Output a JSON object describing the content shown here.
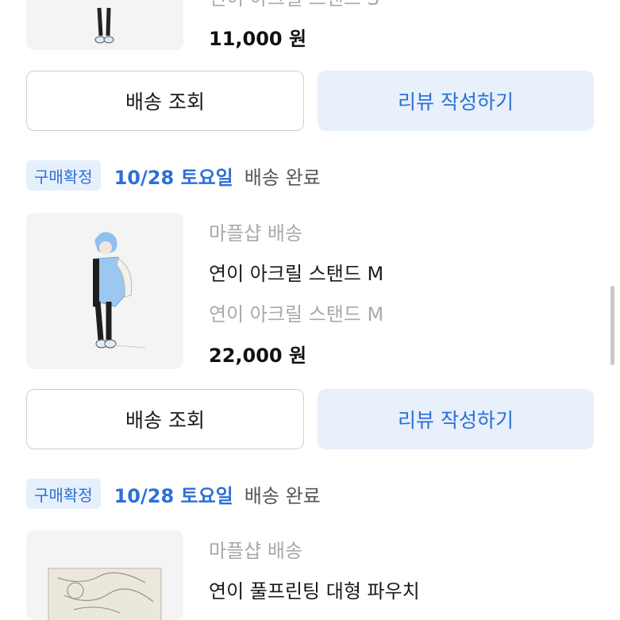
{
  "orders": [
    {
      "product": {
        "price": "11,000 원",
        "partial_option": "연이 아크릴 스탠드 S"
      },
      "buttons": {
        "track": "배송 조회",
        "review": "리뷰 작성하기"
      }
    },
    {
      "status": {
        "badge": "구매확정",
        "date": "10/28 토요일",
        "state": "배송 완료"
      },
      "product": {
        "shipping": "마플샵 배송",
        "name": "연이 아크릴 스탠드 M",
        "option": "연이 아크릴 스탠드 M",
        "price": "22,000 원"
      },
      "buttons": {
        "track": "배송 조회",
        "review": "리뷰 작성하기"
      }
    },
    {
      "status": {
        "badge": "구매확정",
        "date": "10/28 토요일",
        "state": "배송 완료"
      },
      "product": {
        "shipping": "마플샵 배송",
        "name": "연이 풀프린팅 대형 파우치"
      }
    }
  ],
  "colors": {
    "accent": "#2d6fd6",
    "badge_bg": "#e6f0fc",
    "review_button_bg": "#e8f0fb",
    "thumbnail_bg": "#f4f4f4"
  }
}
